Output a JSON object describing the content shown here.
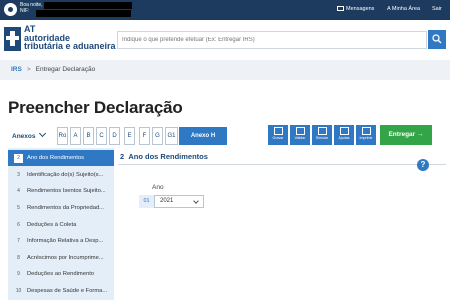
{
  "topbar": {
    "greeting": "Boa noite,",
    "nif_label": "NIF:",
    "links": {
      "messages": "Mensagens",
      "my_area": "A Minha Área",
      "logout": "Sair"
    }
  },
  "header": {
    "brand_line1": "AT",
    "brand_line2": "autoridade",
    "brand_line3": "tributária e aduaneira",
    "search_placeholder": "Indique o que pretende efetuar (Ex: Entregar IRS)"
  },
  "breadcrumb": {
    "root": "IRS",
    "separator": ">",
    "current": "Entregar Declaração"
  },
  "page_title": "Preencher Declaração",
  "annexes_label": "Anexos",
  "tabs": [
    "Ro",
    "A",
    "B",
    "C",
    "D",
    "E",
    "F",
    "G",
    "G1",
    "Anexo H"
  ],
  "tools": {
    "save": "Gravar",
    "validate": "Validar",
    "simulate": "Simular",
    "help": "Ajudas",
    "print": "Imprimir"
  },
  "submit_label": "Entregar",
  "sidebar": {
    "items": [
      {
        "num": "2",
        "label": "Ano dos Rendimentos"
      },
      {
        "num": "3",
        "label": "Identificação do(s) Sujeito(s..."
      },
      {
        "num": "4",
        "label": "Rendimentos Isentos Sujeito..."
      },
      {
        "num": "5",
        "label": "Rendimentos da Propriedad..."
      },
      {
        "num": "6",
        "label": "Deduções à Coleta"
      },
      {
        "num": "7",
        "label": "Informação Relativa a Desp..."
      },
      {
        "num": "8",
        "label": "Acréscimos por Incumprime..."
      },
      {
        "num": "9",
        "label": "Deduções ao Rendimento"
      },
      {
        "num": "10",
        "label": "Despesas de Saúde e Forma..."
      }
    ]
  },
  "main": {
    "section_num": "2",
    "section_title": "Ano dos Rendimentos",
    "help_label": "?",
    "year_label": "Ano",
    "field_code": "01",
    "year_value": "2021"
  },
  "colors": {
    "nav": "#1c3b5e",
    "accent": "#2f78c4",
    "submit": "#33a447",
    "sidebar_bg": "#e4eef8"
  }
}
